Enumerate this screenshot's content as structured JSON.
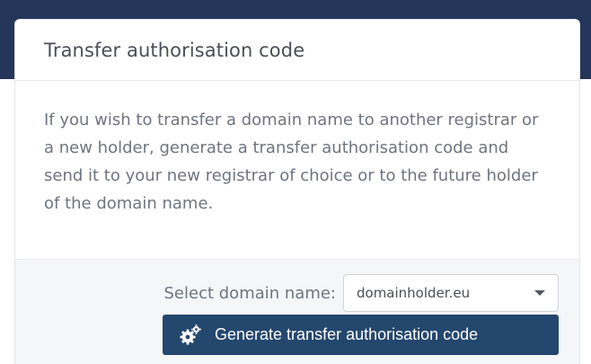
{
  "card": {
    "title": "Transfer authorisation code",
    "description": "If you wish to transfer a domain name to another registrar or a new holder, generate a transfer authorisation code and send it to your new registrar of choice or to the future holder of the domain name."
  },
  "form": {
    "select_label": "Select domain name:",
    "select_value": "domainholder.eu",
    "generate_button_label": "Generate transfer authorisation code",
    "generate_button_icon": "gears-icon"
  },
  "colors": {
    "backdrop": "#24365a",
    "primary_button": "#24476e",
    "footer_background": "#f5f6f8",
    "text": "#6e7580"
  }
}
